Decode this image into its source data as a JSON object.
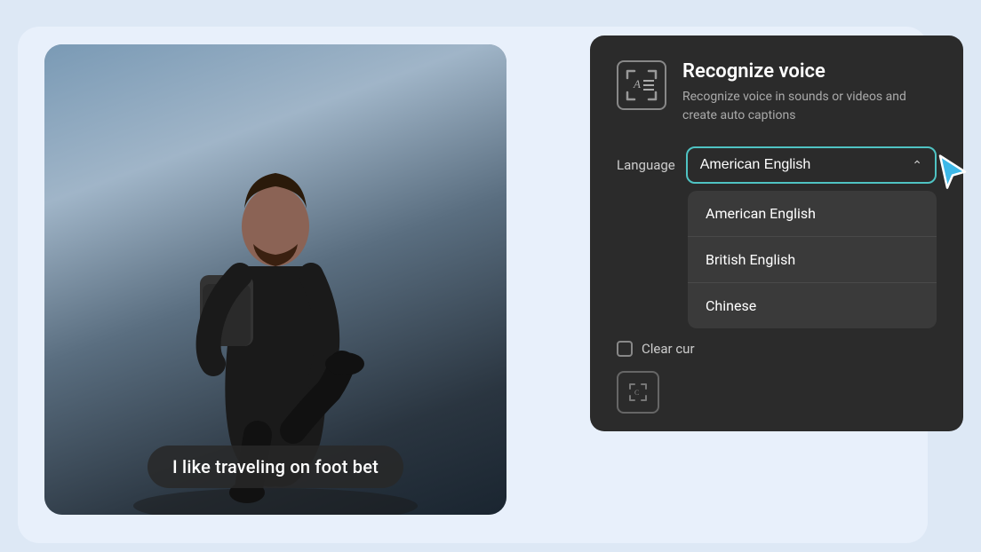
{
  "background": {
    "color": "#dde8f5"
  },
  "caption": {
    "text": "I like traveling on foot bet"
  },
  "panel": {
    "title": "Recognize voice",
    "description": "Recognize voice in sounds or videos and create auto captions",
    "icon_label": "A≡",
    "language_label": "Language",
    "selected_language": "American English",
    "chevron": "∧",
    "clear_label": "Clear cur",
    "dropdown": {
      "items": [
        {
          "id": "american-english",
          "label": "American English"
        },
        {
          "id": "british-english",
          "label": "British English"
        },
        {
          "id": "chinese",
          "label": "Chinese"
        }
      ]
    }
  }
}
